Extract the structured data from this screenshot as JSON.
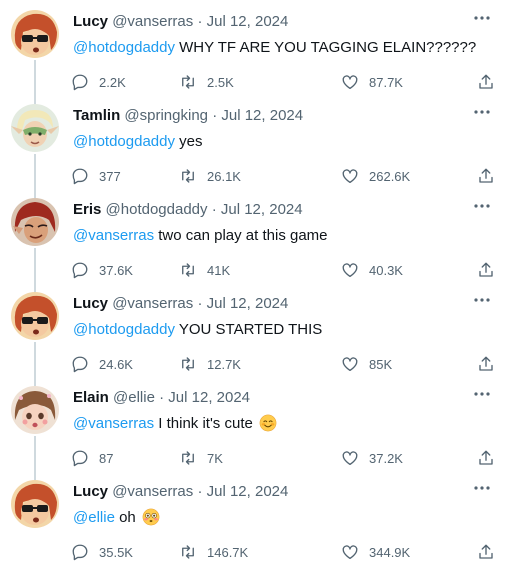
{
  "tweets": [
    {
      "name": "Lucy",
      "handle": "@vanserras",
      "date": "Jul 12, 2024",
      "mention": "@hotdogdaddy",
      "text": " WHY TF ARE YOU TAGGING ELAIN??????",
      "emoji": "",
      "replies": "2.2K",
      "retweets": "2.5K",
      "likes": "87.7K",
      "avatar": "lucy-avatar"
    },
    {
      "name": "Tamlin",
      "handle": "@springking",
      "date": "Jul 12, 2024",
      "mention": "@hotdogdaddy",
      "text": " yes",
      "emoji": "",
      "replies": "377",
      "retweets": "26.1K",
      "likes": "262.6K",
      "avatar": "tamlin-avatar"
    },
    {
      "name": "Eris",
      "handle": "@hotdogdaddy",
      "date": "Jul 12, 2024",
      "mention": "@vanserras",
      "text": " two can play at this game",
      "emoji": "",
      "replies": "37.6K",
      "retweets": "41K",
      "likes": "40.3K",
      "avatar": "eris-avatar"
    },
    {
      "name": "Lucy",
      "handle": "@vanserras",
      "date": "Jul 12, 2024",
      "mention": "@hotdogdaddy",
      "text": " YOU STARTED THIS",
      "emoji": "",
      "replies": "24.6K",
      "retweets": "12.7K",
      "likes": "85K",
      "avatar": "lucy-avatar"
    },
    {
      "name": "Elain",
      "handle": "@ellie",
      "date": "Jul 12, 2024",
      "mention": "@vanserras",
      "text": " I think it's cute",
      "emoji": "smiling-blush-emoji",
      "replies": "87",
      "retweets": "7K",
      "likes": "37.2K",
      "avatar": "elain-avatar"
    },
    {
      "name": "Lucy",
      "handle": "@vanserras",
      "date": "Jul 12, 2024",
      "mention": "@ellie",
      "text": " oh",
      "emoji": "flushed-emoji",
      "replies": "35.5K",
      "retweets": "146.7K",
      "likes": "344.9K",
      "avatar": "lucy-avatar"
    }
  ],
  "separator": "·",
  "colors": {
    "link": "#1d9bf0",
    "muted": "#536471",
    "text": "#0f1419",
    "thread_line": "#cfd9de"
  }
}
